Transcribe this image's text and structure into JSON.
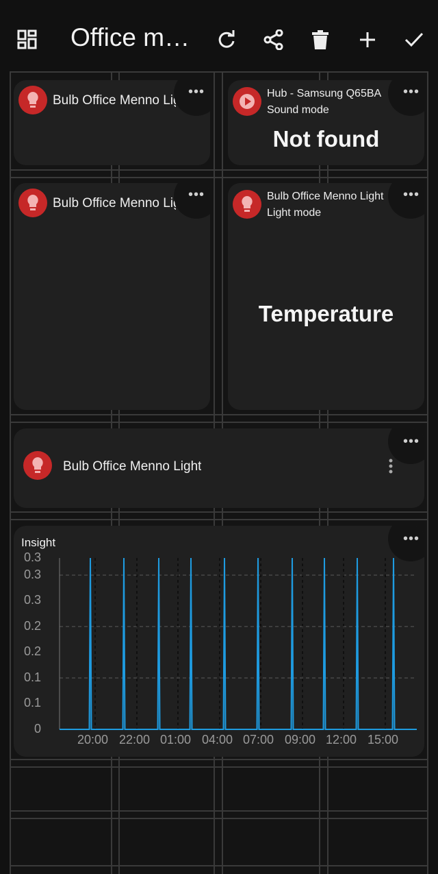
{
  "toolbar": {
    "title": "Office m…",
    "icons": [
      "dashboard-icon",
      "refresh-icon",
      "share-icon",
      "delete-icon",
      "add-icon",
      "check-icon"
    ]
  },
  "cards": {
    "card1": {
      "name": "Bulb Office Menno Light"
    },
    "card2": {
      "name": "Hub - Samsung Q65BA",
      "sub": "Sound mode",
      "value": "Not found"
    },
    "card3": {
      "name": "Bulb Office Menno Light"
    },
    "card4": {
      "name": "Bulb Office Menno Light",
      "sub": "Light mode",
      "value": "Temperature"
    },
    "card5": {
      "name": "Bulb Office Menno Light"
    }
  },
  "insight": {
    "title": "Insight"
  },
  "chart_data": {
    "type": "line",
    "title": "Insight",
    "y_ticks": [
      "0.3",
      "0.3",
      "0.3",
      "0.2",
      "0.2",
      "0.1",
      "0.1",
      "0"
    ],
    "x_ticks": [
      "20:00",
      "22:00",
      "01:00",
      "04:00",
      "07:00",
      "09:00",
      "12:00",
      "15:00"
    ],
    "ylim": [
      0,
      0.33
    ],
    "series": [
      {
        "color": "#1e9be0",
        "spikes": 10,
        "spike_value": 0.33,
        "baseline": 0
      }
    ],
    "grid": true
  },
  "colors": {
    "accent": "#c62828",
    "chart_line": "#1e9be0",
    "card_bg": "#202020"
  }
}
